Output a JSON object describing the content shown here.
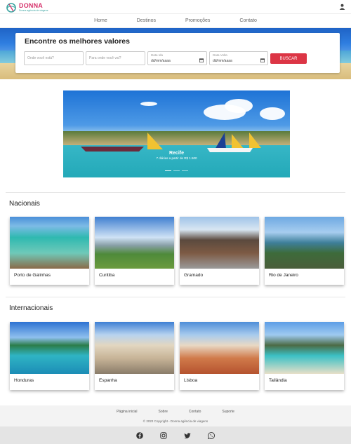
{
  "brand": {
    "name": "DONNA",
    "tagline": "Donna agência de viagens"
  },
  "nav": {
    "items": [
      "Home",
      "Destinos",
      "Promoções",
      "Contato"
    ]
  },
  "search": {
    "title": "Encontre os melhores valores",
    "origin_placeholder": "Onde você está?",
    "destination_placeholder": "Para onde você vai?",
    "departure_label": "Data Ida",
    "return_label": "Data Volta",
    "date_value": "dd/mm/aaaa",
    "button": "BUSCAR"
  },
  "banner": {
    "title": "Recife",
    "subtitle": "7 diárias a partir de R$ 1.500"
  },
  "nacionais": {
    "title": "Nacionais",
    "items": [
      {
        "name": "Porto de Galinhas"
      },
      {
        "name": "Curitiba"
      },
      {
        "name": "Gramado"
      },
      {
        "name": "Rio de Janeiro"
      }
    ]
  },
  "internacionais": {
    "title": "Internacionais",
    "items": [
      {
        "name": "Honduras"
      },
      {
        "name": "Espanha"
      },
      {
        "name": "Lisboa"
      },
      {
        "name": "Tailândia"
      }
    ]
  },
  "footer": {
    "links": [
      "Página inicial",
      "Sobre",
      "Contato",
      "Suporte"
    ],
    "copyright": "© 2022 Copyright - Donna agência de viagens"
  },
  "colors": {
    "accent": "#dc3545",
    "brand": "#d6336c",
    "teal": "#3aa3a0"
  }
}
